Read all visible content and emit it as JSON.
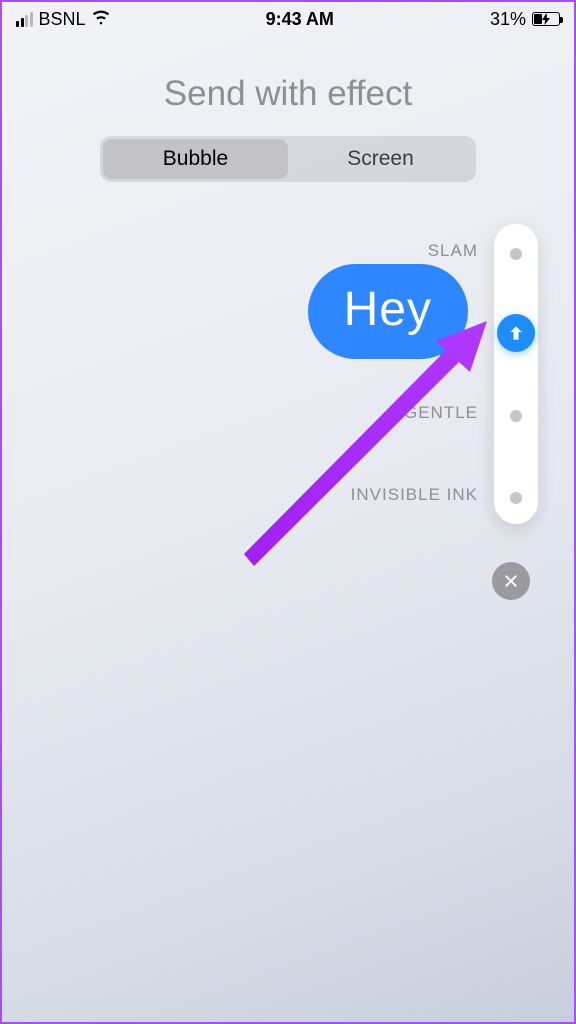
{
  "status": {
    "carrier": "BSNL",
    "time": "9:43 AM",
    "battery_pct": "31%"
  },
  "title": "Send with effect",
  "segmented": {
    "bubble": "Bubble",
    "screen": "Screen",
    "selected": "bubble"
  },
  "effects": {
    "slam": "SLAM",
    "gentle": "GENTLE",
    "invisible_ink": "INVISIBLE INK"
  },
  "message": {
    "text": "Hey"
  },
  "colors": {
    "accent_blue": "#2f87ff",
    "send_blue": "#1f8dff",
    "annotation_purple": "#a020f0"
  }
}
